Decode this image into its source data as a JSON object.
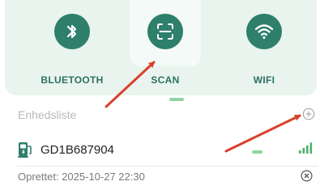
{
  "connection_options": [
    {
      "label": "BLUETOOTH",
      "icon": "bluetooth-icon"
    },
    {
      "label": "SCAN",
      "icon": "scan-icon"
    },
    {
      "label": "WIFI",
      "icon": "wifi-icon"
    }
  ],
  "device_list": {
    "header": "Enhedsliste",
    "add_icon": "plus-circle-icon",
    "devices": [
      {
        "name": "GD1B687904",
        "icon": "ev-charger-icon",
        "status_icon": "signal-icon",
        "created": "Oprettet:  2025-10-27 22:30",
        "remove_icon": "close-circle-icon"
      }
    ]
  },
  "colors": {
    "accent": "#2e7f6b",
    "panel": "#e9f4ef",
    "label": "#2d7060",
    "indicator": "#8fd4a0",
    "annotation_arrow": "#d9412b"
  }
}
